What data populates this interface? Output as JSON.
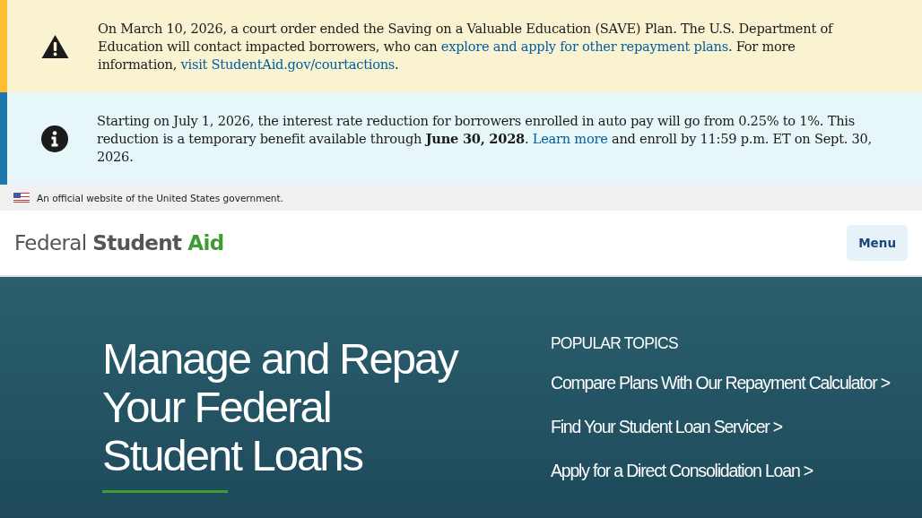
{
  "alerts": [
    {
      "kind": "warning",
      "segments": [
        {
          "kind": "text",
          "text": "On March 10, 2026, a court order ended the Saving on a Valuable Education (SAVE) Plan. The U.S. Department of Education will contact impacted borrowers, who can "
        },
        {
          "kind": "link",
          "text": "explore and apply for other repayment plans"
        },
        {
          "kind": "text",
          "text": ". For more information, "
        },
        {
          "kind": "link",
          "text": "visit StudentAid.gov/courtactions"
        },
        {
          "kind": "text",
          "text": "."
        }
      ]
    },
    {
      "kind": "info",
      "segments": [
        {
          "kind": "text",
          "text": "Starting on July 1, 2026, the interest rate reduction for borrowers enrolled in auto pay will go from 0.25% to 1%. This reduction is a temporary benefit available through **June 30, 2028**. "
        },
        {
          "kind": "link",
          "text": "Learn more"
        },
        {
          "kind": "text",
          "text": " and enroll by 11:59 p.m. ET on Sept. 30, 2026."
        }
      ]
    }
  ],
  "gov_banner": {
    "text": "An official website of the United States government."
  },
  "header": {
    "logo": {
      "part_1": "Federal",
      "part_2": "Student",
      "part_3": "Aid"
    },
    "menu_button": "Menu"
  },
  "hero": {
    "title": "Manage and Repay Your Federal Student Loans",
    "topics_heading": "POPULAR TOPICS",
    "topics": [
      "Compare Plans With Our Repayment Calculator >",
      "Find Your Student Loan Servicer >",
      "Apply for a Direct Consolidation Loan >"
    ]
  }
}
